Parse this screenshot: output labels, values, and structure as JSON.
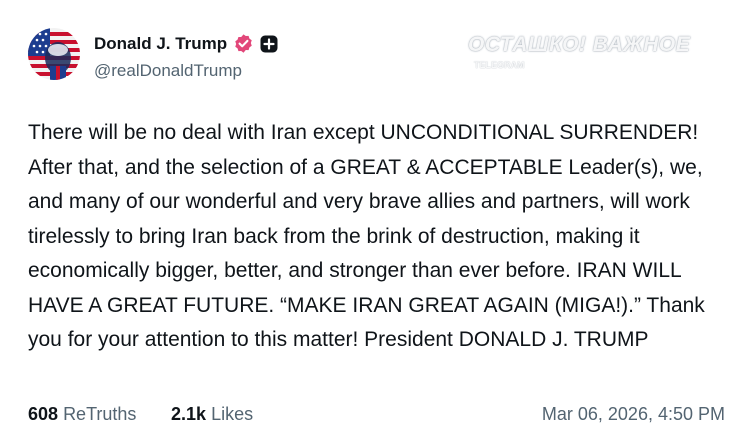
{
  "post": {
    "author": {
      "display_name": "Donald J. Trump",
      "handle": "@realDonaldTrump",
      "verified_icon": "verified-badge-icon",
      "follow_icon": "plus-icon"
    },
    "text": "There will be no deal with Iran except UNCONDITIONAL SURRENDER! After that, and the selection of a GREAT & ACCEPTABLE Leader(s), we, and many of our wonderful and very brave allies and partners, will work tirelessly to bring Iran back from the brink of destruction, making it economically bigger, better, and stronger than ever before. IRAN WILL HAVE A GREAT FUTURE. “MAKE IRAN GREAT AGAIN (MIGA!).” Thank you for your attention to this matter! President DONALD J. TRUMP",
    "retruths_count": "608",
    "retruths_label": "ReTruths",
    "likes_count": "2.1k",
    "likes_label": "Likes",
    "timestamp": "Mar 06, 2026, 4:50 PM"
  },
  "watermark": {
    "title": "ОСТАШКО! ВАЖНОЕ",
    "subtitle": "TELEGRAM"
  },
  "colors": {
    "text_primary": "#0f1419",
    "text_secondary": "#536471",
    "verified_badge": "#e2477a"
  }
}
